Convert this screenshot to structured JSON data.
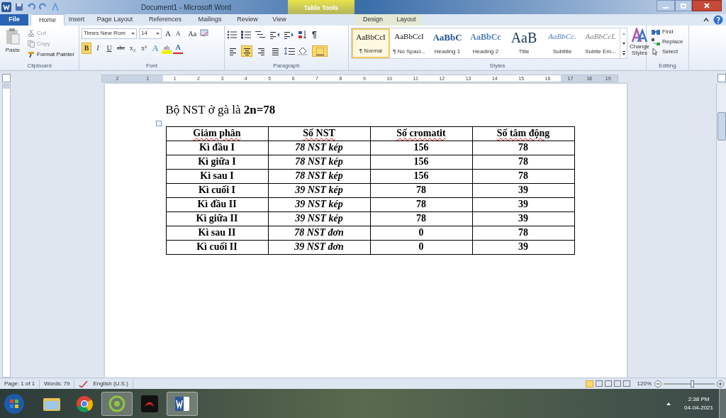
{
  "window": {
    "title": "Document1  -  Microsoft Word",
    "context_tab_group": "Table Tools"
  },
  "tabs": [
    {
      "label": "File",
      "kind": "file",
      "selected": false
    },
    {
      "label": "Home",
      "kind": "tab",
      "selected": true
    },
    {
      "label": "Insert",
      "kind": "tab",
      "selected": false
    },
    {
      "label": "Page Layout",
      "kind": "tab",
      "selected": false
    },
    {
      "label": "References",
      "kind": "tab",
      "selected": false
    },
    {
      "label": "Mailings",
      "kind": "tab",
      "selected": false
    },
    {
      "label": "Review",
      "kind": "tab",
      "selected": false
    },
    {
      "label": "View",
      "kind": "tab",
      "selected": false
    },
    {
      "label": "Design",
      "kind": "context",
      "selected": false
    },
    {
      "label": "Layout",
      "kind": "context",
      "selected": false
    }
  ],
  "clipboard": {
    "label": "Clipboard",
    "paste": "Paste",
    "items": [
      {
        "kind": "cut",
        "label": "Cut",
        "disabled": true
      },
      {
        "kind": "copy",
        "label": "Copy",
        "disabled": true
      },
      {
        "kind": "brush",
        "label": "Format Painter",
        "disabled": false
      }
    ]
  },
  "font": {
    "label": "Font",
    "font_name": "Times New Rom",
    "font_size": "14",
    "row1": [
      {
        "text": "A",
        "kind": "grow"
      },
      {
        "text": "A",
        "kind": "shrink"
      },
      {
        "text": "Aa",
        "kind": "case"
      }
    ],
    "row2": [
      {
        "text": "B",
        "kind": "bold",
        "on": true
      },
      {
        "text": "I",
        "kind": "italic",
        "on": false
      },
      {
        "text": "U",
        "kind": "underline",
        "on": false
      },
      {
        "text": "abe",
        "kind": "strike",
        "on": false
      },
      {
        "text": "x₂",
        "kind": "sub",
        "on": false
      },
      {
        "text": "x²",
        "kind": "sup",
        "on": false
      },
      {
        "text": "A",
        "kind": "effects",
        "on": false
      },
      {
        "text": "ab",
        "kind": "highlight",
        "on": false
      },
      {
        "text": "A",
        "kind": "color",
        "on": false
      }
    ]
  },
  "paragraph": {
    "label": "Paragraph",
    "pilcrow": "¶",
    "alignment": [
      {
        "kind": "left",
        "selected": false
      },
      {
        "kind": "center",
        "selected": true
      },
      {
        "kind": "right",
        "selected": false
      },
      {
        "kind": "justify",
        "selected": false
      }
    ]
  },
  "styles": {
    "label": "Styles",
    "items": [
      {
        "preview": "AaBbCcI",
        "label": "¶ Normal",
        "kind": "normal",
        "selected": true
      },
      {
        "preview": "AaBbCcI",
        "label": "¶ No Spaci...",
        "kind": "normal",
        "selected": false
      },
      {
        "preview": "AaBbC",
        "label": "Heading 1",
        "kind": "heading1",
        "selected": false
      },
      {
        "preview": "AaBbCc",
        "label": "Heading 2",
        "kind": "heading2",
        "selected": false
      },
      {
        "preview": "AaB",
        "label": "Title",
        "kind": "title",
        "selected": false
      },
      {
        "preview": "AaBbCc.",
        "label": "Subtitle",
        "kind": "subtitle",
        "selected": false
      },
      {
        "preview": "AaBbCcL",
        "label": "Subtle Em...",
        "kind": "subtle",
        "selected": false
      }
    ],
    "change_styles": "Change Styles"
  },
  "editing": {
    "label": "Editing",
    "items": [
      {
        "kind": "find",
        "label": "Find"
      },
      {
        "kind": "replace",
        "label": "Replace"
      },
      {
        "kind": "select",
        "label": "Select"
      }
    ]
  },
  "ruler": [
    "2",
    "1",
    "1",
    "2",
    "3",
    "4",
    "5",
    "6",
    "7",
    "8",
    "9",
    "10",
    "11",
    "12",
    "13",
    "14",
    "15",
    "16",
    "17",
    "18",
    "19"
  ],
  "document": {
    "heading": "Bộ NST ở gà là **2n=78**",
    "table": {
      "columns": [
        "Giảm phân",
        "Số NST",
        "Số cromatit",
        "Số tâm động"
      ],
      "rows": [
        [
          "Kì đầu I",
          "78 NST kép",
          "156",
          "78"
        ],
        [
          "Kì giữa I",
          "78 NST kép",
          "156",
          "78"
        ],
        [
          "Kì sau I",
          "78 NST kép",
          "156",
          "78"
        ],
        [
          "Kì cuối I",
          "39 NST kép",
          "78",
          "39"
        ],
        [
          "Kì đầu II",
          "39 NST kép",
          "78",
          "39"
        ],
        [
          "Kì giữa II",
          "39 NST kép",
          "78",
          "39"
        ],
        [
          "Kì sau II",
          "78 NST đơn",
          "0",
          "78"
        ],
        [
          "Kì cuối II",
          "39 NST đơn",
          "0",
          "39"
        ]
      ]
    }
  },
  "status_bar": {
    "page": "Page: 1 of 1",
    "words": "Words: 79",
    "language": "English (U.S.)",
    "zoom": "120%",
    "zoom_slider": {
      "level": 0.55
    }
  },
  "taskbar": {
    "apps": [
      {
        "kind": "folder",
        "selected": false
      },
      {
        "kind": "chrome",
        "selected": false
      },
      {
        "kind": "green",
        "selected": true
      },
      {
        "kind": "garena",
        "selected": false
      },
      {
        "kind": "word",
        "selected": true
      }
    ],
    "time": "2:38 PM",
    "date": "04-04-2021"
  }
}
